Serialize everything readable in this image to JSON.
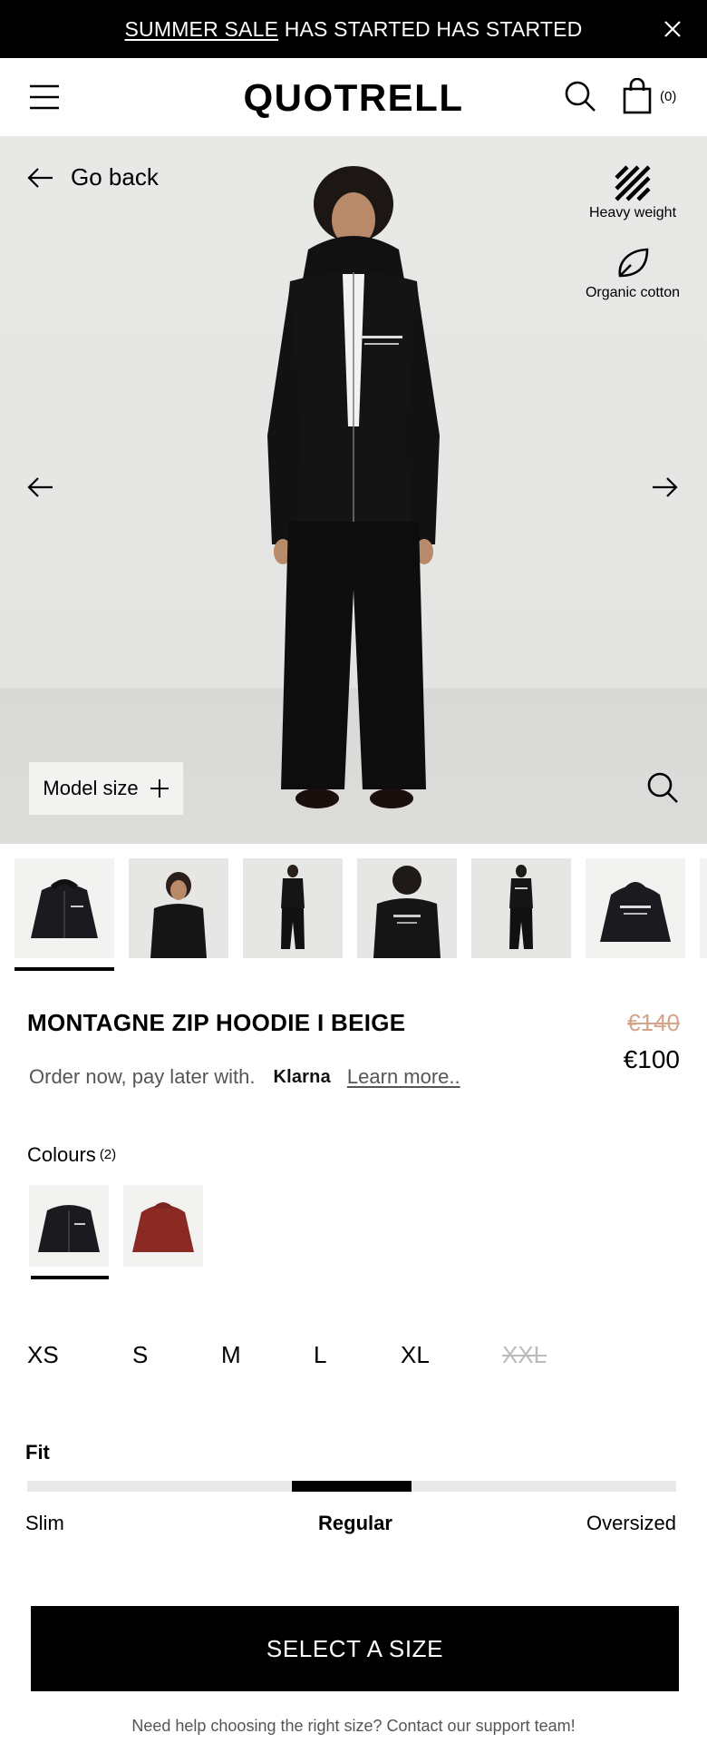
{
  "announcement": {
    "link_text": "SUMMER SALE",
    "text": " HAS STARTED HAS STARTED"
  },
  "header": {
    "logo": "QUOTRELL",
    "cart_count": "(0)"
  },
  "hero": {
    "go_back": "Go back",
    "badges": [
      {
        "label": "Heavy weight",
        "icon": "stripes-icon"
      },
      {
        "label": "Organic cotton",
        "icon": "leaf-icon"
      }
    ],
    "model_size": "Model size"
  },
  "gallery": {
    "thumbnail_count": 6,
    "active_index": 0
  },
  "product": {
    "title": "MONTAGNE ZIP HOODIE I BEIGE",
    "price_old": "€140",
    "price_new": "€100",
    "klarna_text": "Order now, pay later with.",
    "klarna_brand": "Klarna",
    "learn_more": "Learn more.."
  },
  "colours": {
    "label": "Colours",
    "count": "(2)",
    "options": [
      "black",
      "burgundy"
    ],
    "selected": 0
  },
  "sizes": {
    "options": [
      {
        "label": "XS",
        "available": true
      },
      {
        "label": "S",
        "available": true
      },
      {
        "label": "M",
        "available": true
      },
      {
        "label": "L",
        "available": true
      },
      {
        "label": "XL",
        "available": true
      },
      {
        "label": "XXL",
        "available": false
      }
    ]
  },
  "fit": {
    "label": "Fit",
    "slim": "Slim",
    "regular": "Regular",
    "oversized": "Oversized",
    "position": "Regular"
  },
  "cta": {
    "label": "SELECT A SIZE"
  },
  "help_text": "Need help choosing the right size? Contact our support team!",
  "colors": {
    "announcement_bg": "#000000",
    "sale_strike": "#d4a48a",
    "cta_bg": "#000000"
  }
}
